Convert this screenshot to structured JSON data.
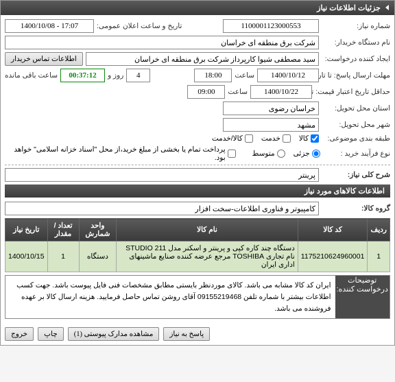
{
  "panel_title": "جزئیات اطلاعات نیاز",
  "labels": {
    "need_no": "شماره نیاز:",
    "announce_datetime": "تاریخ و ساعت اعلان عمومی:",
    "buyer_name": "نام دستگاه خریدار:",
    "requester": "ایجاد کننده درخواست:",
    "contact_btn": "اطلاعات تماس خریدار",
    "reply_until": "مهلت ارسال پاسخ: تا تاریخ:",
    "hour": "ساعت",
    "days_and": "روز و",
    "remain": "ساعت باقی مانده",
    "validity_until": "حداقل تاریخ اعتبار قیمت: تا تاریخ:",
    "province": "استان محل تحویل:",
    "city": "شهر محل تحویل:",
    "category": "طبقه بندی موضوعی:",
    "goods": "کالا",
    "service": "خدمت",
    "goods_service": "کالا/خدمت",
    "purchase_type": "نوع فرآیند خرید :",
    "partial": "جزئی",
    "medium": "متوسط",
    "partial_note": "پرداخت تمام یا بخشی از مبلغ خرید،از محل \"اسناد خزانه اسلامی\" خواهد بود.",
    "summary": "شرح کلی نیاز:",
    "items_header": "اطلاعات کالاهای مورد نیاز",
    "goods_group": "گروه کالا:",
    "requester_notes_label": "توضیحات درخواست کننده:",
    "reply_btn": "پاسخ به نیاز",
    "attachments_btn": "مشاهده مدارک پیوستی (1)",
    "print_btn": "چاپ",
    "exit_btn": "خروج"
  },
  "values": {
    "need_no": "1100001123000553",
    "announce_date": "1400/10/08 - 17:07",
    "buyer_name": "شرکت برق منطقه ای خراسان",
    "requester": "سید مصطفی شیوا کارپرداز شرکت برق منطقه ای خراسان",
    "reply_date": "1400/10/12",
    "reply_hour": "18:00",
    "days_left": "4",
    "time_left": "00:37:12",
    "validity_date": "1400/10/22",
    "validity_hour": "09:00",
    "province": "خراسان رضوی",
    "city": "مشهد",
    "summary_text": "پرینتر",
    "goods_group_text": "کامپیوتر و فناوری اطلاعات-سخت افزار",
    "requester_notes": "ایران کد کالا مشابه می باشد. کالای موردنظر بایستی مطابق مشخصات فنی فایل پیوست باشد. جهت کسب اطلاعات بیشتر با شماره تلفن 09155219468 آقای روشن تماس حاصل فرمایید. هزینه ارسال کالا بر عهده فروشنده می باشد."
  },
  "table": {
    "headers": {
      "row": "ردیف",
      "code": "کد کالا",
      "name": "نام کالا",
      "unit": "واحد شمارش",
      "qty": "تعداد / مقدار",
      "date": "تاریخ نیاز"
    },
    "rows": [
      {
        "row": "1",
        "code": "1175210624960001",
        "name": "دستگاه چند کاره کپی و پرینتر و اسکنر مدل STUDIO 211 نام تجاری TOSHIBA مرجع عرضه کننده صنایع ماشینهای اداری ایران",
        "unit": "دستگاه",
        "qty": "1",
        "date": "1400/10/15"
      }
    ]
  }
}
